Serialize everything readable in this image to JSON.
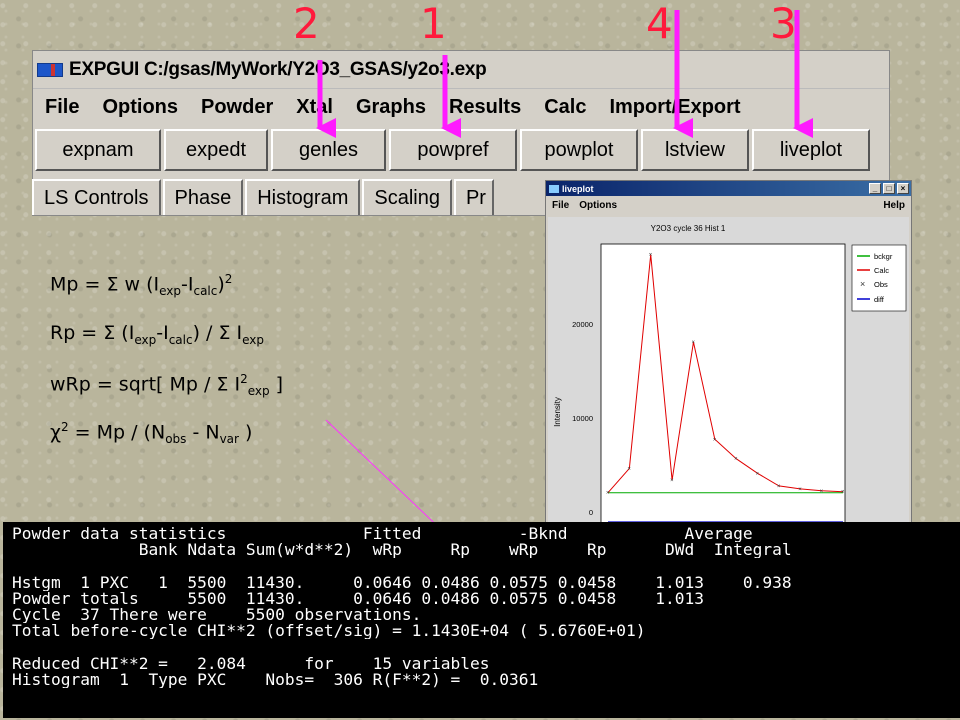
{
  "window": {
    "title": "EXPGUI C:/gsas/MyWork/Y2O3_GSAS/y2o3.exp",
    "menu": [
      "File",
      "Options",
      "Powder",
      "Xtal",
      "Graphs",
      "Results",
      "Calc",
      "Import/Export"
    ],
    "toolbar": [
      "expnam",
      "expedt",
      "genles",
      "powpref",
      "powplot",
      "lstview",
      "liveplot"
    ],
    "tabs": [
      "LS Controls",
      "Phase",
      "Histogram",
      "Scaling",
      "Pr"
    ]
  },
  "markers": [
    "2",
    "1",
    "4",
    "3"
  ],
  "formulas": {
    "mp": {
      "lhs": "Mp",
      "body": " = Σ w (I",
      "s1": "exp",
      "m1": "-I",
      "s2": "calc",
      "tail": ")",
      "sup": "2"
    },
    "rp": {
      "lhs": "Rp",
      "body": " = Σ (I",
      "s1": "exp",
      "m1": "-I",
      "s2": "calc",
      "m2": ") / Σ I",
      "s3": "exp"
    },
    "wrp": {
      "lhs": "wRp",
      "body": " = sqrt[ Mp / Σ I",
      "sup": "2",
      "s1": "exp",
      "tail": " ]"
    },
    "chi": {
      "lhs": "χ",
      "sup": "2",
      "body": " = Mp / (N",
      "s1": "obs",
      "m1": " - N",
      "s2": "var",
      "tail": " )"
    }
  },
  "liveplot": {
    "window_title": "liveplot",
    "menu_file": "File",
    "menu_options": "Options",
    "menu_help": "Help",
    "plot_title": "Y2O3 cycle 36 Hist 1",
    "ylabel": "Intensity",
    "ytick_labels": [
      "20000",
      "10000",
      "0"
    ],
    "legend": [
      {
        "label": "bckgr",
        "color": "#00aa00"
      },
      {
        "label": "Calc",
        "color": "#e00000"
      },
      {
        "label": "Obs",
        "color": "#333333"
      },
      {
        "label": "diff",
        "color": "#0000cc"
      }
    ]
  },
  "chart_data": {
    "type": "line",
    "title": "Y2O3 cycle 36 Hist 1",
    "ylabel": "Intensity",
    "xlabel": "",
    "ylim": [
      -2000,
      26000
    ],
    "series": [
      {
        "name": "bckgr",
        "values": [
          500,
          500,
          500,
          500
        ]
      },
      {
        "name": "Calc",
        "values": [
          500,
          3000,
          25000,
          1800,
          16000,
          6000,
          4000,
          2500,
          1200,
          900,
          700,
          600
        ]
      },
      {
        "name": "Obs",
        "values": [
          500,
          3000,
          25000,
          1800,
          16000,
          6000,
          4000,
          2500,
          1200,
          900,
          700,
          600
        ]
      },
      {
        "name": "diff",
        "values": [
          -2500,
          -2500,
          -2500,
          -2500
        ]
      }
    ]
  },
  "console": {
    "lines": [
      "Powder data statistics              Fitted          -Bknd            Average",
      "             Bank Ndata Sum(w*d**2)  wRp     Rp    wRp     Rp      DWd  Integral",
      "",
      "Hstgm  1 PXC   1  5500  11430.     0.0646 0.0486 0.0575 0.0458    1.013    0.938",
      "Powder totals     5500  11430.     0.0646 0.0486 0.0575 0.0458    1.013",
      "Cycle  37 There were    5500 observations.",
      "Total before-cycle CHI**2 (offset/sig) = 1.1430E+04 ( 5.6760E+01)",
      "",
      "Reduced CHI**2 =   2.084      for    15 variables",
      "Histogram  1  Type PXC    Nobs=  306 R(F**2) =  0.0361"
    ]
  }
}
